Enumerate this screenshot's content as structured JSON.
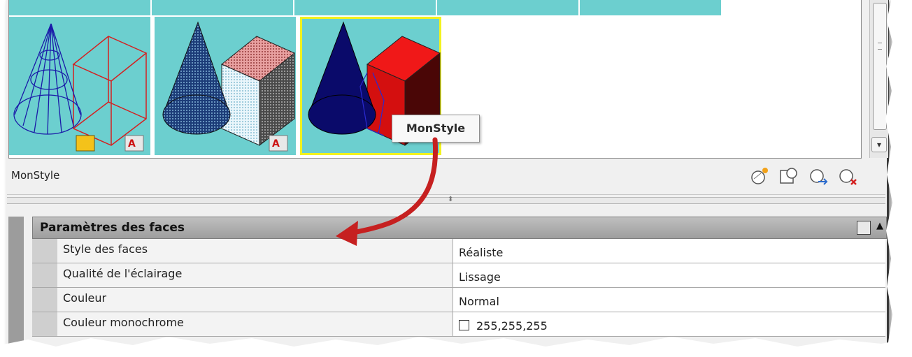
{
  "gallery": {
    "selected_style_name": "MonStyle",
    "tooltip": "MonStyle",
    "thumbnails": [
      {
        "name": "wireframe-style"
      },
      {
        "name": "shaded-dotted-style"
      },
      {
        "name": "MonStyle",
        "selected": true
      }
    ]
  },
  "toolbar": {
    "icons": [
      "create-style-icon",
      "apply-to-viewport-icon",
      "export-to-palette-icon",
      "delete-style-icon"
    ]
  },
  "properties": {
    "section_title": "Paramètres des faces",
    "rows": [
      {
        "name": "Style des faces",
        "value": "Réaliste"
      },
      {
        "name": "Qualité de l'éclairage",
        "value": "Lissage"
      },
      {
        "name": "Couleur",
        "value": "Normal"
      },
      {
        "name": "Couleur monochrome",
        "value": "255,255,255"
      }
    ]
  },
  "colors": {
    "thumbnail_bg": "#6ccfcf",
    "selection": "#f2f21e",
    "arrow": "#c62020"
  }
}
